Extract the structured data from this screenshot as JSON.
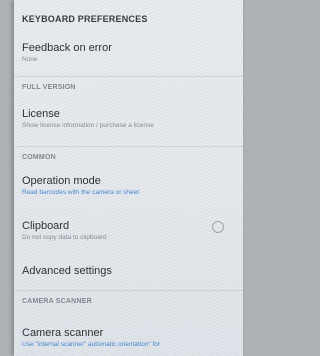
{
  "sections": {
    "keyboard": "KEYBOARD PREFERENCES",
    "full_version": "FULL VERSION",
    "common": "COMMON",
    "camera_scanner": "CAMERA SCANNER"
  },
  "prefs": {
    "feedback": {
      "title": "Feedback on error",
      "summary": "None"
    },
    "license": {
      "title": "License",
      "summary": "Show license information / purchase a license"
    },
    "operation_mode": {
      "title": "Operation mode",
      "summary": "Read barcodes with the camera or sheet"
    },
    "clipboard": {
      "title": "Clipboard",
      "summary": "Do not copy data to clipboard",
      "enabled": false
    },
    "advanced": {
      "title": "Advanced settings"
    },
    "camera_scanner": {
      "title": "Camera scanner",
      "summary": "Use \"internal scanner\" automatic orientation\" for"
    }
  }
}
